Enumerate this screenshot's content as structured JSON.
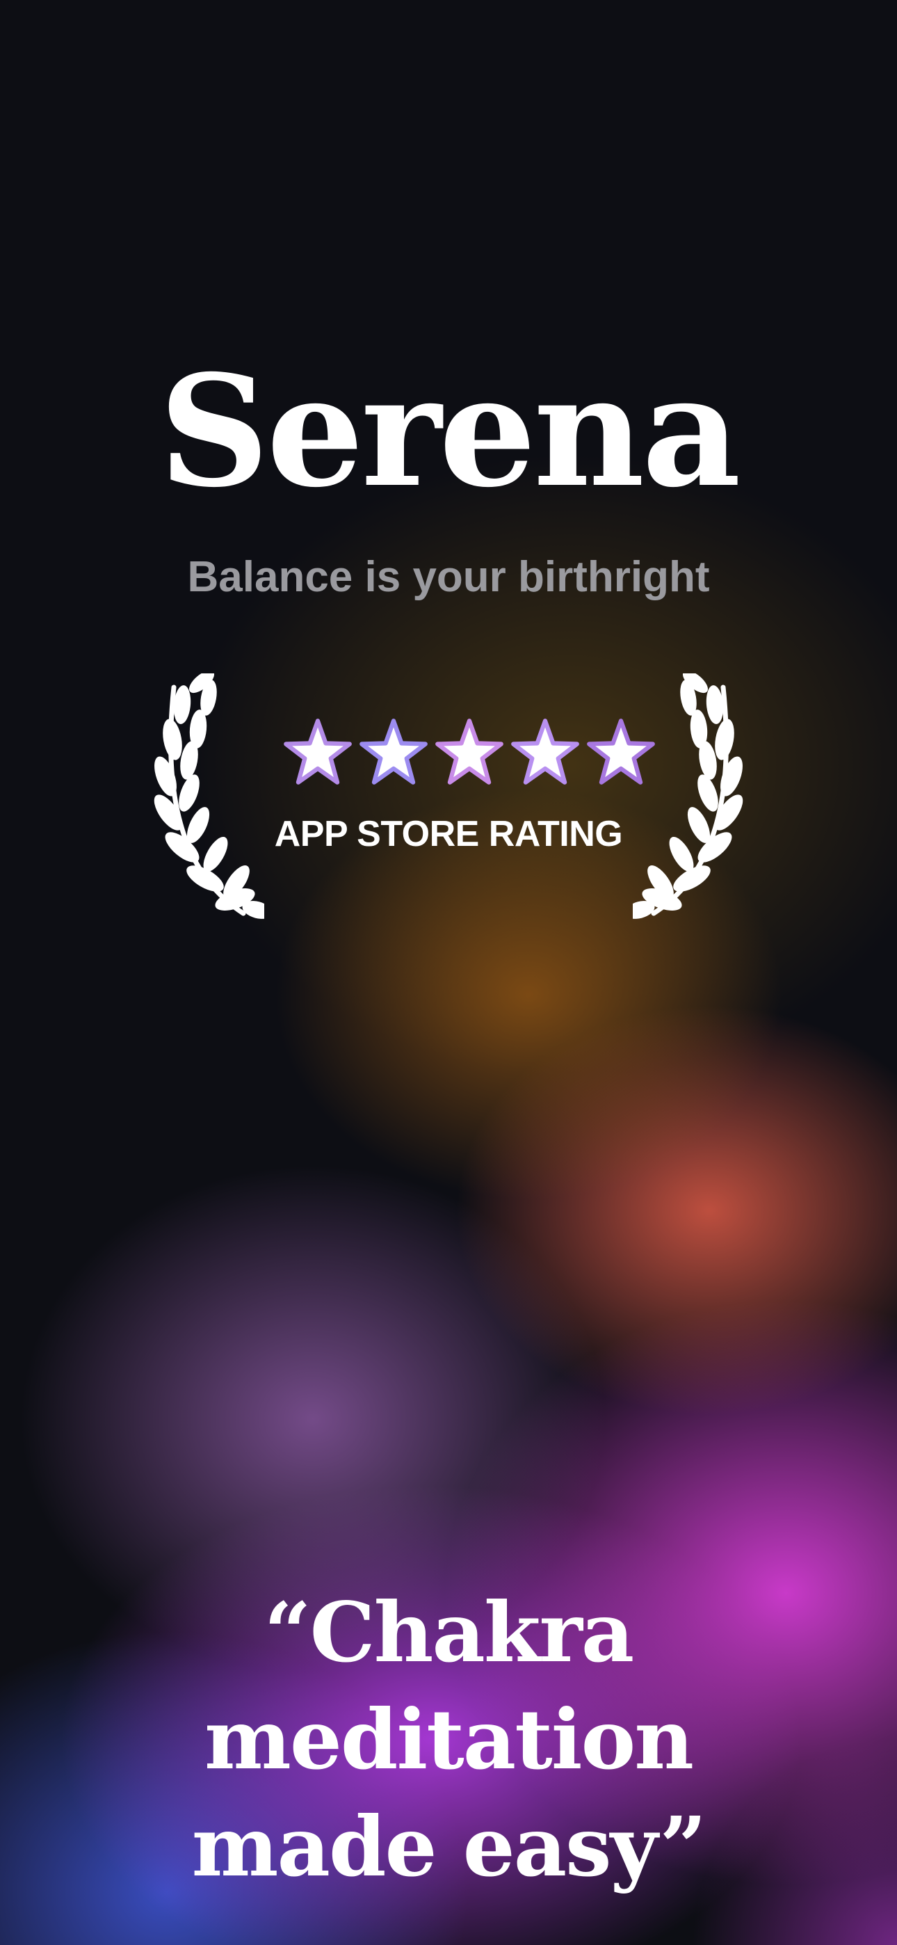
{
  "app": {
    "title": "Serena",
    "subtitle": "Balance is your birthright"
  },
  "rating": {
    "stars": 5,
    "max_stars": 5,
    "label": "APP STORE RATING",
    "star_icon": "star-icon",
    "laurel_icon": "laurel-icon"
  },
  "quote": {
    "line1": "“Chakra meditation",
    "line2": "made easy”"
  },
  "colors": {
    "background": "#0d0e14",
    "text": "#ffffff",
    "subtitle": "#9a9a9f",
    "accent_magenta": "#d23cd2",
    "accent_orange": "#dc5a46",
    "accent_blue": "#3c50c8"
  }
}
